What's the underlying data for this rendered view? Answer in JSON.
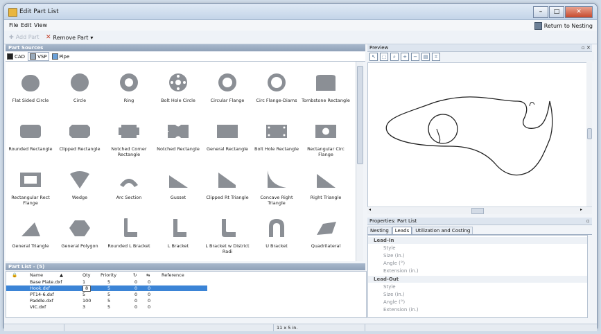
{
  "window": {
    "title": "Edit Part List"
  },
  "menu": {
    "file": "File",
    "edit": "Edit",
    "view": "View"
  },
  "toolbar": {
    "add_part": "Add Part",
    "remove_part": "Remove Part",
    "return_label": "Return to Nesting"
  },
  "part_sources": {
    "header": "Part Sources",
    "tabs": [
      "CAD",
      "VSP",
      "Pipe"
    ],
    "shapes": [
      "Flat Sided Circle",
      "Circle",
      "Ring",
      "Bolt Hole Circle",
      "Circular Flange",
      "Circ Flange-Diams",
      "Tombstone Rectangle",
      "Rounded Rectangle",
      "Clipped Rectangle",
      "Notched Corner Rectangle",
      "Notched Rectangle",
      "General Rectangle",
      "Bolt Hole Rectangle",
      "Rectangular Circ Flange",
      "Rectangular Rect Flange",
      "Wedge",
      "Arc Section",
      "Gusset",
      "Clipped Rt Triangle",
      "Concave Right Triangle",
      "Right Triangle",
      "General Triangle",
      "General Polygon",
      "Rounded L Bracket",
      "L Bracket",
      "L Bracket w District Radi",
      "U Bracket",
      "Quadrilateral"
    ]
  },
  "part_list": {
    "header": "Part List - (5)",
    "columns": {
      "name": "Name",
      "qty": "Qty",
      "priority": "Priority",
      "reference": "Reference"
    },
    "rows": [
      {
        "name": "Base Plate.dxf",
        "qty": "1",
        "priority": "5",
        "c1": "0",
        "c2": "0"
      },
      {
        "name": "Hook.dxf",
        "qty": "8",
        "priority": "5",
        "c1": "0",
        "c2": "0"
      },
      {
        "name": "PT14-6.dxf",
        "qty": "5",
        "priority": "5",
        "c1": "0",
        "c2": "0"
      },
      {
        "name": "Paddle.dxf",
        "qty": "100",
        "priority": "5",
        "c1": "0",
        "c2": "0"
      },
      {
        "name": "VIC.dxf",
        "qty": "3",
        "priority": "5",
        "c1": "0",
        "c2": "0"
      }
    ]
  },
  "preview": {
    "header": "Preview"
  },
  "properties": {
    "header": "Properties: Part List",
    "tabs": [
      "Nesting",
      "Leads",
      "Utilization and Costing"
    ],
    "lead_in": "Lead-In",
    "lead_out": "Lead-Out",
    "in_items": [
      "Style",
      "Size (in.)",
      "Angle (°)",
      "Extension (in.)"
    ],
    "out_items": [
      "Style",
      "Size (in.)",
      "Angle (°)",
      "Extension (in.)"
    ]
  },
  "status": {
    "sheet": "11 x 5 in."
  }
}
